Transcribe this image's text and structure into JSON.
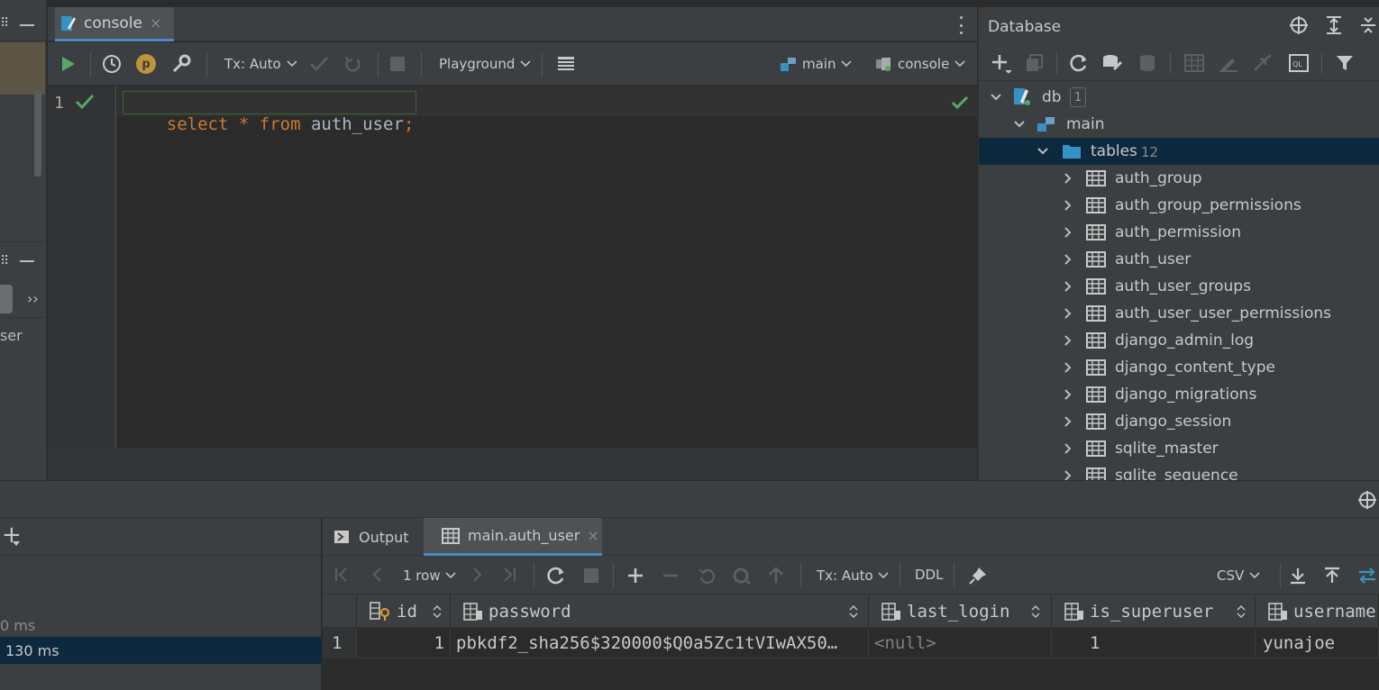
{
  "editor": {
    "tab_label": "console",
    "tab_close": "×",
    "toolbar": {
      "tx_mode": "Tx: Auto",
      "playground": "Playground",
      "schema": "main",
      "session": "console"
    },
    "line_number": "1",
    "sql": {
      "kw_select": "select",
      "star": "*",
      "kw_from": "from",
      "table": "auth_user",
      "semicolon": ";"
    }
  },
  "left": {
    "fragment_user": "ser",
    "chevrons": "››",
    "time_1": "0 ms",
    "time_2": "130 ms",
    "plus": "+"
  },
  "database": {
    "title": "Database",
    "db_name": "db",
    "db_count": "1",
    "schema": "main",
    "tables_label": "tables",
    "tables_count": "12",
    "tables": [
      "auth_group",
      "auth_group_permissions",
      "auth_permission",
      "auth_user",
      "auth_user_groups",
      "auth_user_user_permissions",
      "django_admin_log",
      "django_content_type",
      "django_migrations",
      "django_session",
      "sqlite_master",
      "sqlite_sequence"
    ]
  },
  "results": {
    "tabs": {
      "output": "Output",
      "table": "main.auth_user",
      "close": "×"
    },
    "toolbar": {
      "rows": "1 row",
      "tx_mode": "Tx: Auto",
      "ddl": "DDL",
      "export_format": "CSV"
    },
    "columns": [
      "id",
      "password",
      "last_login",
      "is_superuser",
      "username"
    ],
    "rows": [
      {
        "row_num": "1",
        "id": "1",
        "password": "pbkdf2_sha256$320000$Q0a5Zc1tVIwAX50…",
        "last_login": "<null>",
        "is_superuser": "1",
        "username": "yunajoe"
      }
    ]
  },
  "colors": {
    "background": "#2b2b2b",
    "panel": "#3c3f41",
    "keyword": "#cc7832",
    "selection": "#0d293e",
    "success": "#59a869",
    "folder": "#3592c4"
  }
}
